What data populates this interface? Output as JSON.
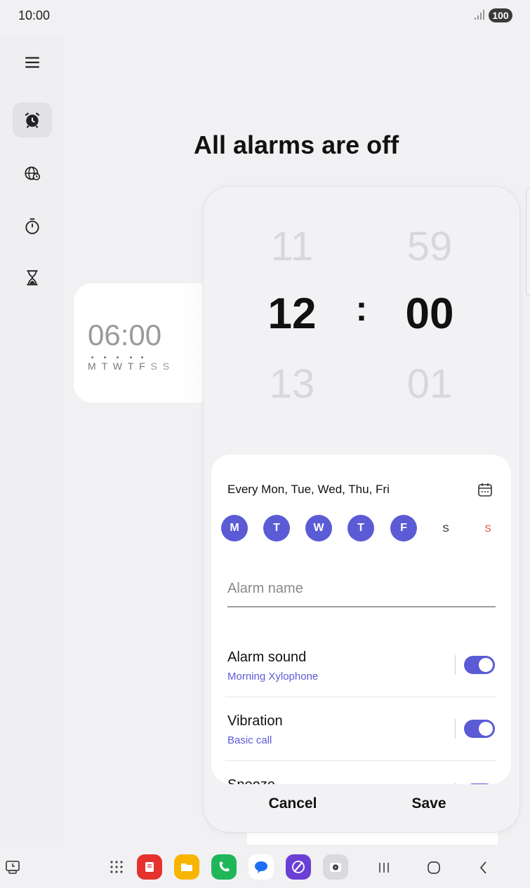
{
  "status": {
    "time": "10:00",
    "battery": "100"
  },
  "nav_rail": {
    "items": [
      {
        "icon": "menu-icon"
      },
      {
        "icon": "alarm-clock-icon",
        "active": true
      },
      {
        "icon": "world-clock-icon"
      },
      {
        "icon": "stopwatch-icon"
      },
      {
        "icon": "timer-hourglass-icon"
      }
    ]
  },
  "main": {
    "empty_title": "All alarms are off"
  },
  "background_alarm": {
    "time": "06:00",
    "days": [
      "M",
      "T",
      "W",
      "T",
      "F",
      "S",
      "S"
    ]
  },
  "picker": {
    "hour_prev": "11",
    "hour": "12",
    "hour_next": "13",
    "separator": ":",
    "minute_prev": "59",
    "minute": "00",
    "minute_next": "01"
  },
  "repeat": {
    "summary": "Every Mon, Tue, Wed, Thu, Fri",
    "days": [
      {
        "label": "M",
        "selected": true
      },
      {
        "label": "T",
        "selected": true
      },
      {
        "label": "W",
        "selected": true
      },
      {
        "label": "T",
        "selected": true
      },
      {
        "label": "F",
        "selected": true
      },
      {
        "label": "S",
        "selected": false
      },
      {
        "label": "S",
        "selected": false
      }
    ]
  },
  "alarm_name": {
    "placeholder": "Alarm name",
    "value": ""
  },
  "settings": [
    {
      "title": "Alarm sound",
      "subtitle": "Morning Xylophone",
      "enabled": true
    },
    {
      "title": "Vibration",
      "subtitle": "Basic call",
      "enabled": true
    },
    {
      "title": "Snooze",
      "subtitle": "",
      "enabled": true
    }
  ],
  "actions": {
    "cancel": "Cancel",
    "save": "Save"
  },
  "colors": {
    "accent": "#5b5bd6",
    "sunday": "#d84a3c",
    "background": "#f1f1f3"
  },
  "taskbar": {
    "apps": [
      "app-drawer-icon",
      "notes-app-icon",
      "files-app-icon",
      "phone-app-icon",
      "messages-app-icon",
      "browser-app-icon",
      "camera-app-icon"
    ],
    "nav": [
      "recents-icon",
      "home-icon",
      "back-icon"
    ]
  }
}
